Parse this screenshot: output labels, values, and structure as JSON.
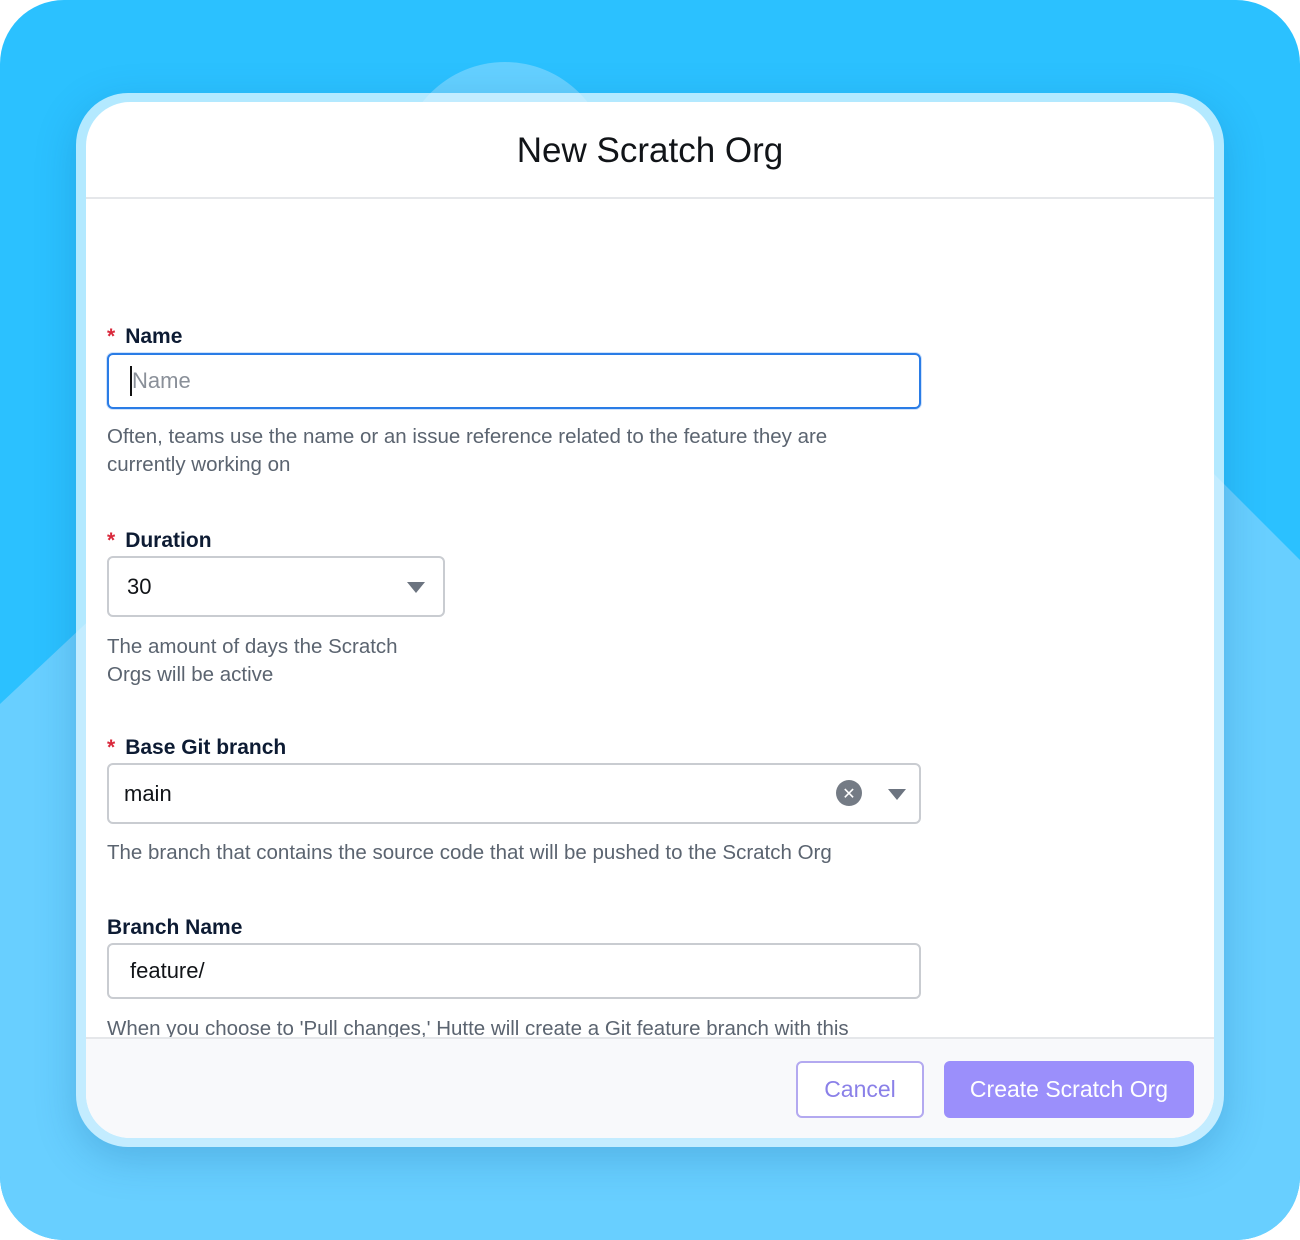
{
  "modal": {
    "title": "New Scratch Org"
  },
  "fields": {
    "name": {
      "label": "Name",
      "required_marker": "*",
      "placeholder": "Name",
      "value": "",
      "help": "Often, teams use the name or an issue reference related to the feature they are currently working on"
    },
    "duration": {
      "label": "Duration",
      "required_marker": "*",
      "value": "30",
      "help": "The amount of days the Scratch Orgs will be active"
    },
    "base_branch": {
      "label": "Base Git branch",
      "required_marker": "*",
      "value": "main",
      "help": "The branch that contains the source code that will be pushed to the Scratch Org"
    },
    "branch_name": {
      "label": "Branch Name",
      "value": "feature/",
      "help": "When you choose to 'Pull changes,' Hutte will create a Git feature branch with this name"
    }
  },
  "footer": {
    "cancel_label": "Cancel",
    "create_label": "Create Scratch Org"
  },
  "icons": {
    "dropdown": "chevron-down-icon",
    "clear": "clear-icon"
  },
  "colors": {
    "accent": "#9b8ffb",
    "focus": "#2a7ce6",
    "required": "#d9283b",
    "background": "#2bc1ff"
  }
}
